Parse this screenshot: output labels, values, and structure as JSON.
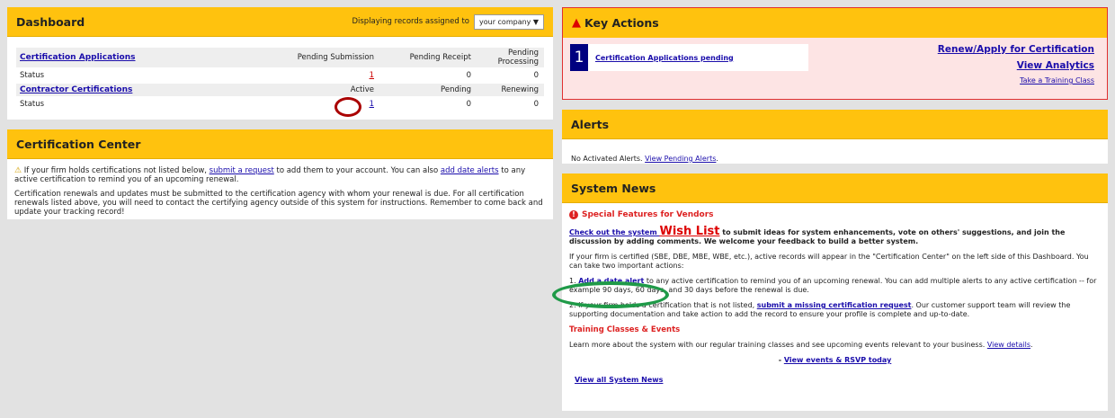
{
  "dashboard": {
    "title": "Dashboard",
    "displaying_label": "Displaying records assigned to",
    "select_value": "your company",
    "cert_apps": {
      "link": "Certification Applications",
      "col1": "Pending Submission",
      "col2": "Pending Receipt",
      "col3": "Pending Processing",
      "status_label": "Status",
      "v1": "1",
      "v2": "0",
      "v3": "0"
    },
    "contractor": {
      "link": "Contractor Certifications",
      "col1": "Active",
      "col2": "Pending",
      "col3": "Renewing",
      "status_label": "Status",
      "v1": "1",
      "v2": "0",
      "v3": "0"
    }
  },
  "cert_center": {
    "title": "Certification Center",
    "p1_pre": " If your firm holds certifications not listed below, ",
    "p1_link1": "submit a request",
    "p1_mid": " to add them to your account. You can also ",
    "p1_link2": "add date alerts",
    "p1_post": " to any active certification to remind you of an upcoming renewal.",
    "p2": "Certification renewals and updates must be submitted to the certification agency with whom your renewal is due. For all certification renewals listed above, you will need to contact the certifying agency outside of this system for instructions. Remember to come back and update your tracking record!"
  },
  "key_actions": {
    "title": "Key Actions",
    "count": "1",
    "item_label": "Certification Applications pending",
    "link1": "Renew/Apply for Certification",
    "link2": "View Analytics",
    "link3": "Take a Training Class"
  },
  "alerts": {
    "title": "Alerts",
    "text": "No Activated Alerts. ",
    "link": "View Pending Alerts",
    "suffix": "."
  },
  "system_news": {
    "title": "System News",
    "special": "Special Features for Vendors",
    "wish_pre": "Check out the system ",
    "wish_link": "Wish List",
    "wish_post": " to submit ideas for system enhancements, vote on others' suggestions, and join the discussion by adding comments. We welcome your feedback to build a better system.",
    "p_certified": "If your firm is certified (SBE, DBE, MBE, WBE, etc.), active records will appear in the \"Certification Center\" on the left side of this Dashboard. You can take two important actions:",
    "a1_pre": "1. ",
    "a1_link": "Add a date alert",
    "a1_post": " to any active certification to remind you of an upcoming renewal. You can add multiple alerts to any active certification -- for example 90 days, 60 days, and 30 days before the renewal is due.",
    "a2_pre": "2. If your firm holds a certification that is not listed, ",
    "a2_link": "submit a missing certification request",
    "a2_post": ". Our customer support team will review the supporting documentation and take action to add the record to ensure your profile is complete and up-to-date.",
    "training_head": "Training Classes & Events",
    "training_text": "Learn more about the system with our regular training classes and see upcoming events relevant to your business. ",
    "training_link": "View details",
    "training_suffix": ".",
    "rsvp_pre": "- ",
    "rsvp_link": "View events & RSVP today",
    "view_all": "View all System News"
  },
  "colors": {
    "header_yellow": "#ffc20e",
    "key_actions_bg": "#fde4e4",
    "key_actions_border": "#e03030",
    "badge_navy": "#000080",
    "highlight_red": "#a00000",
    "highlight_green": "#1f9a48"
  },
  "icons": {
    "select_caret": "▼",
    "warning": "⚠",
    "alert": "▲",
    "special": "!"
  }
}
